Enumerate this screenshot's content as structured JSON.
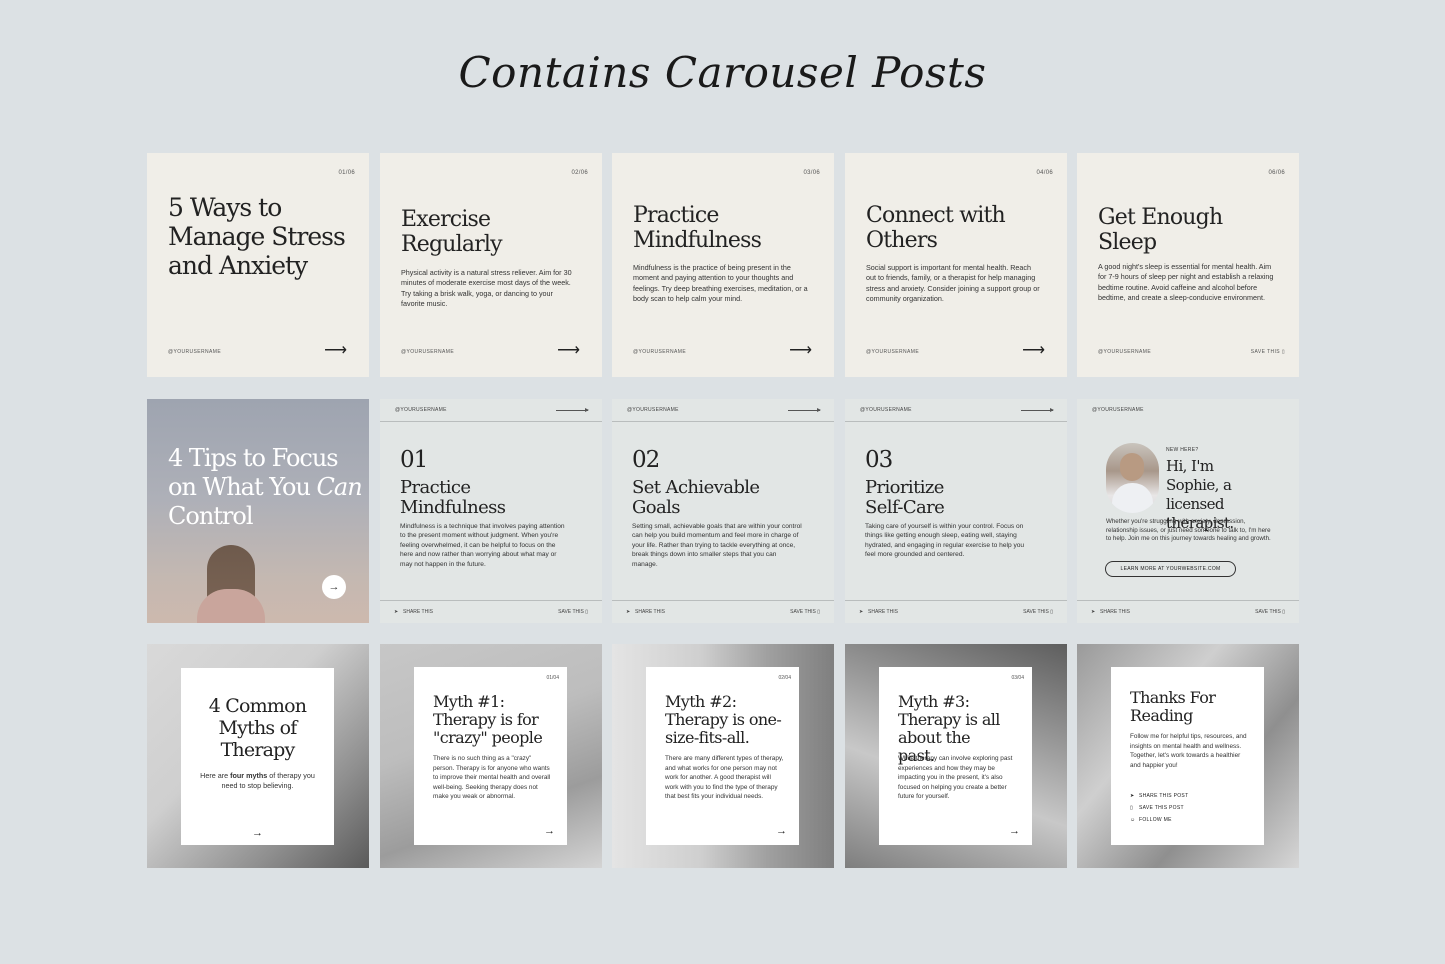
{
  "page_title": "Contains Carousel Posts",
  "username": "@YOURUSERNAME",
  "share_label": "SHARE THIS",
  "save_label": "SAVE THIS",
  "row1": [
    {
      "page": "01/06",
      "title": "5 Ways to Manage Stress and Anxiety"
    },
    {
      "page": "02/06",
      "title": "Exercise Regularly",
      "body": "Physical activity is a natural stress reliever. Aim for 30 minutes of moderate exercise most days of the week. Try taking a brisk walk, yoga, or dancing to your favorite music."
    },
    {
      "page": "03/06",
      "title": "Practice Mindfulness",
      "body": "Mindfulness is the practice of being present in the moment and paying attention to your thoughts and feelings. Try deep breathing exercises, meditation, or a body scan to help calm your mind."
    },
    {
      "page": "04/06",
      "title": "Connect with Others",
      "body": "Social support is important for mental health. Reach out to friends, family, or a therapist for help managing stress and anxiety. Consider joining a support group or community organization."
    },
    {
      "page": "06/06",
      "title": "Get Enough Sleep",
      "body": "A good night's sleep is essential for mental health. Aim for 7-9 hours of sleep per night and establish a relaxing bedtime routine. Avoid caffeine and alcohol before bedtime, and create a sleep-conducive environment."
    }
  ],
  "row2": {
    "intro": {
      "title_a": "4 Tips to Focus on What You",
      "title_em": "Can",
      "title_b": " Control"
    },
    "tips": [
      {
        "num": "01",
        "title": "Practice Mindfulness",
        "body": "Mindfulness is a technique that involves paying attention to the present moment without judgment. When you're feeling overwhelmed, it can be helpful to focus on the here and now rather than worrying about what may or may not happen in the future."
      },
      {
        "num": "02",
        "title": "Set Achievable Goals",
        "body": "Setting small, achievable goals that are within your control can help you build momentum and feel more in charge of your life. Rather than trying to tackle everything at once, break things down into smaller steps that you can manage."
      },
      {
        "num": "03",
        "title": "Prioritize Self-Care",
        "body": "Taking care of yourself is within your control. Focus on things like getting enough sleep, eating well, staying hydrated, and engaging in regular exercise to help you feel more grounded and centered."
      }
    ],
    "about": {
      "eyebrow": "NEW HERE?",
      "title": "Hi, I'm Sophie, a licensed therapist.",
      "body": "Whether you're struggling with anxiety, depression, relationship issues, or just need someone to talk to, I'm here to help. Join me on this journey towards healing and growth.",
      "cta": "LEARN MORE AT YOURWEBSITE.COM"
    }
  },
  "row3": {
    "intro": {
      "title": "4 Common Myths of Therapy",
      "body_a": "Here are ",
      "body_b": "four myths",
      "body_c": " of therapy you need to stop believing."
    },
    "myths": [
      {
        "page": "01/04",
        "title": "Myth #1: Therapy is for \"crazy\" people",
        "body": "There is no such thing as a \"crazy\" person. Therapy is for anyone who wants to improve their mental health and overall well-being. Seeking therapy does not make you weak or abnormal."
      },
      {
        "page": "02/04",
        "title": "Myth #2: Therapy is one-size-fits-all.",
        "body": "There are many different types of therapy, and what works for one person may not work for another. A good therapist will work with you to find the type of therapy that best fits your individual needs."
      },
      {
        "page": "03/04",
        "title": "Myth #3: Therapy is all about the past.",
        "body": "While therapy can involve exploring past experiences and how they may be impacting you in the present, it's also focused on helping you create a better future for yourself."
      }
    ],
    "outro": {
      "title": "Thanks For Reading",
      "body": "Follow me for helpful tips, resources, and insights on mental health and wellness. Together, let's work towards a healthier and happier you!",
      "share": "SHARE THIS POST",
      "save": "SAVE THIS POST",
      "follow": "FOLLOW ME"
    }
  }
}
